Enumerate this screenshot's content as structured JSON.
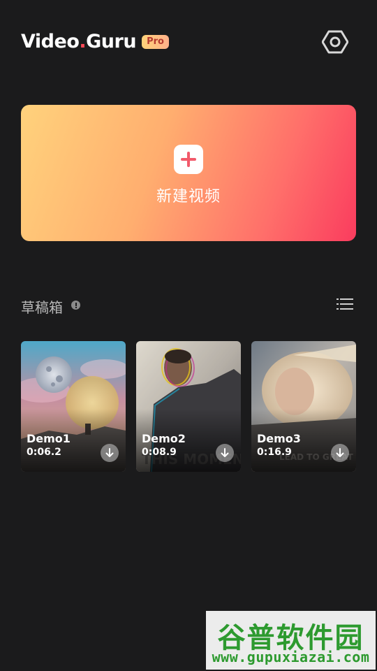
{
  "header": {
    "logo_main": "Video",
    "logo_dot": ".",
    "logo_tail": "Guru",
    "badge": "Pro",
    "settings_icon": "gear-hexagon-icon"
  },
  "create": {
    "label": "新建视频",
    "icon": "plus-icon"
  },
  "drafts": {
    "title": "草稿箱",
    "info_icon": "info-icon",
    "list_icon": "list-view-icon"
  },
  "demos": [
    {
      "name": "Demo1",
      "duration": "0:06.2"
    },
    {
      "name": "Demo2",
      "duration": "0:08.9"
    },
    {
      "name": "Demo3",
      "duration": "0:16.9"
    }
  ],
  "watermark": {
    "title": "谷普软件园",
    "url": "www.gupuxiazai.com"
  },
  "colors": {
    "background": "#1b1b1c",
    "accent": "#fa3c5e",
    "badge": "#ffc27e",
    "gradient_start": "#ffd27c",
    "gradient_end": "#fa3c5e"
  }
}
